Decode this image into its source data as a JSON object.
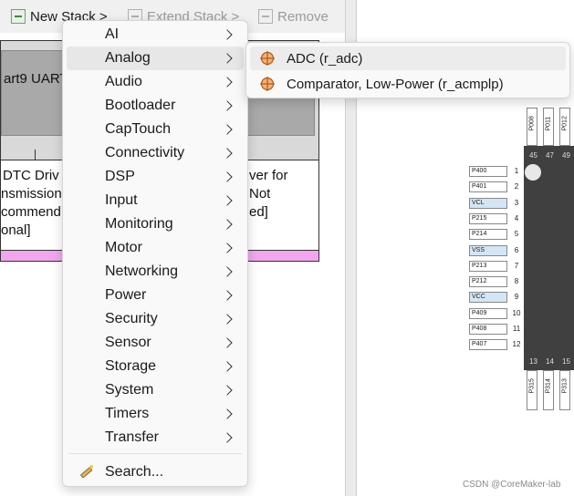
{
  "toolbar": {
    "new_stack": "New Stack >",
    "extend_stack": "Extend Stack >",
    "remove": "Remove"
  },
  "stack_panel": {
    "uart_label": "art9 UART",
    "dtc_lines": [
      " DTC Driv",
      "nsmission ",
      "commend",
      "onal]"
    ],
    "right_lines": [
      "ver for",
      "Not",
      "ed]"
    ]
  },
  "menu": {
    "items": [
      {
        "label": "AI",
        "icon": "submenu-arrow"
      },
      {
        "label": "Analog",
        "icon": "submenu-arrow",
        "active": true
      },
      {
        "label": "Audio",
        "icon": "submenu-arrow"
      },
      {
        "label": "Bootloader",
        "icon": "submenu-arrow"
      },
      {
        "label": "CapTouch",
        "icon": "submenu-arrow"
      },
      {
        "label": "Connectivity",
        "icon": "submenu-arrow"
      },
      {
        "label": "DSP",
        "icon": "submenu-arrow"
      },
      {
        "label": "Input",
        "icon": "submenu-arrow"
      },
      {
        "label": "Monitoring",
        "icon": "submenu-arrow"
      },
      {
        "label": "Motor",
        "icon": "submenu-arrow"
      },
      {
        "label": "Networking",
        "icon": "submenu-arrow"
      },
      {
        "label": "Power",
        "icon": "submenu-arrow"
      },
      {
        "label": "Security",
        "icon": "submenu-arrow"
      },
      {
        "label": "Sensor",
        "icon": "submenu-arrow"
      },
      {
        "label": "Storage",
        "icon": "submenu-arrow"
      },
      {
        "label": "System",
        "icon": "submenu-arrow"
      },
      {
        "label": "Timers",
        "icon": "submenu-arrow"
      },
      {
        "label": "Transfer",
        "icon": "submenu-arrow"
      }
    ],
    "search_label": "Search..."
  },
  "submenu": {
    "items": [
      {
        "label": "ADC (r_adc)",
        "icon": "component-icon"
      },
      {
        "label": "Comparator, Low-Power (r_acmplp)",
        "icon": "component-icon"
      }
    ]
  },
  "pins": {
    "top": [
      "P008",
      "P011",
      "P012"
    ],
    "top_nums": [
      "45",
      "47",
      "49"
    ],
    "left": [
      {
        "label": "P400",
        "num": "1"
      },
      {
        "label": "P401",
        "num": "2"
      },
      {
        "label": "VCL",
        "num": "3",
        "highlight": true
      },
      {
        "label": "P215",
        "num": "4"
      },
      {
        "label": "P214",
        "num": "5"
      },
      {
        "label": "VSS",
        "num": "6",
        "highlight": true
      },
      {
        "label": "P213",
        "num": "7"
      },
      {
        "label": "P212",
        "num": "8"
      },
      {
        "label": "VCC",
        "num": "9",
        "highlight": true
      },
      {
        "label": "P409",
        "num": "10"
      },
      {
        "label": "P408",
        "num": "11"
      },
      {
        "label": "P407",
        "num": "12"
      }
    ],
    "bottom": [
      "P315",
      "P314",
      "P313"
    ],
    "bottom_nums": [
      "13",
      "14",
      "15"
    ]
  },
  "watermark": "CSDN @CoreMaker-lab",
  "colors": {
    "menu_bg": "#f9f9f9",
    "active_bg": "#e7e7e7",
    "pink_bar": "#f2a6ee",
    "chip": "#404040",
    "pin_highlight": "#d4e6f6"
  }
}
